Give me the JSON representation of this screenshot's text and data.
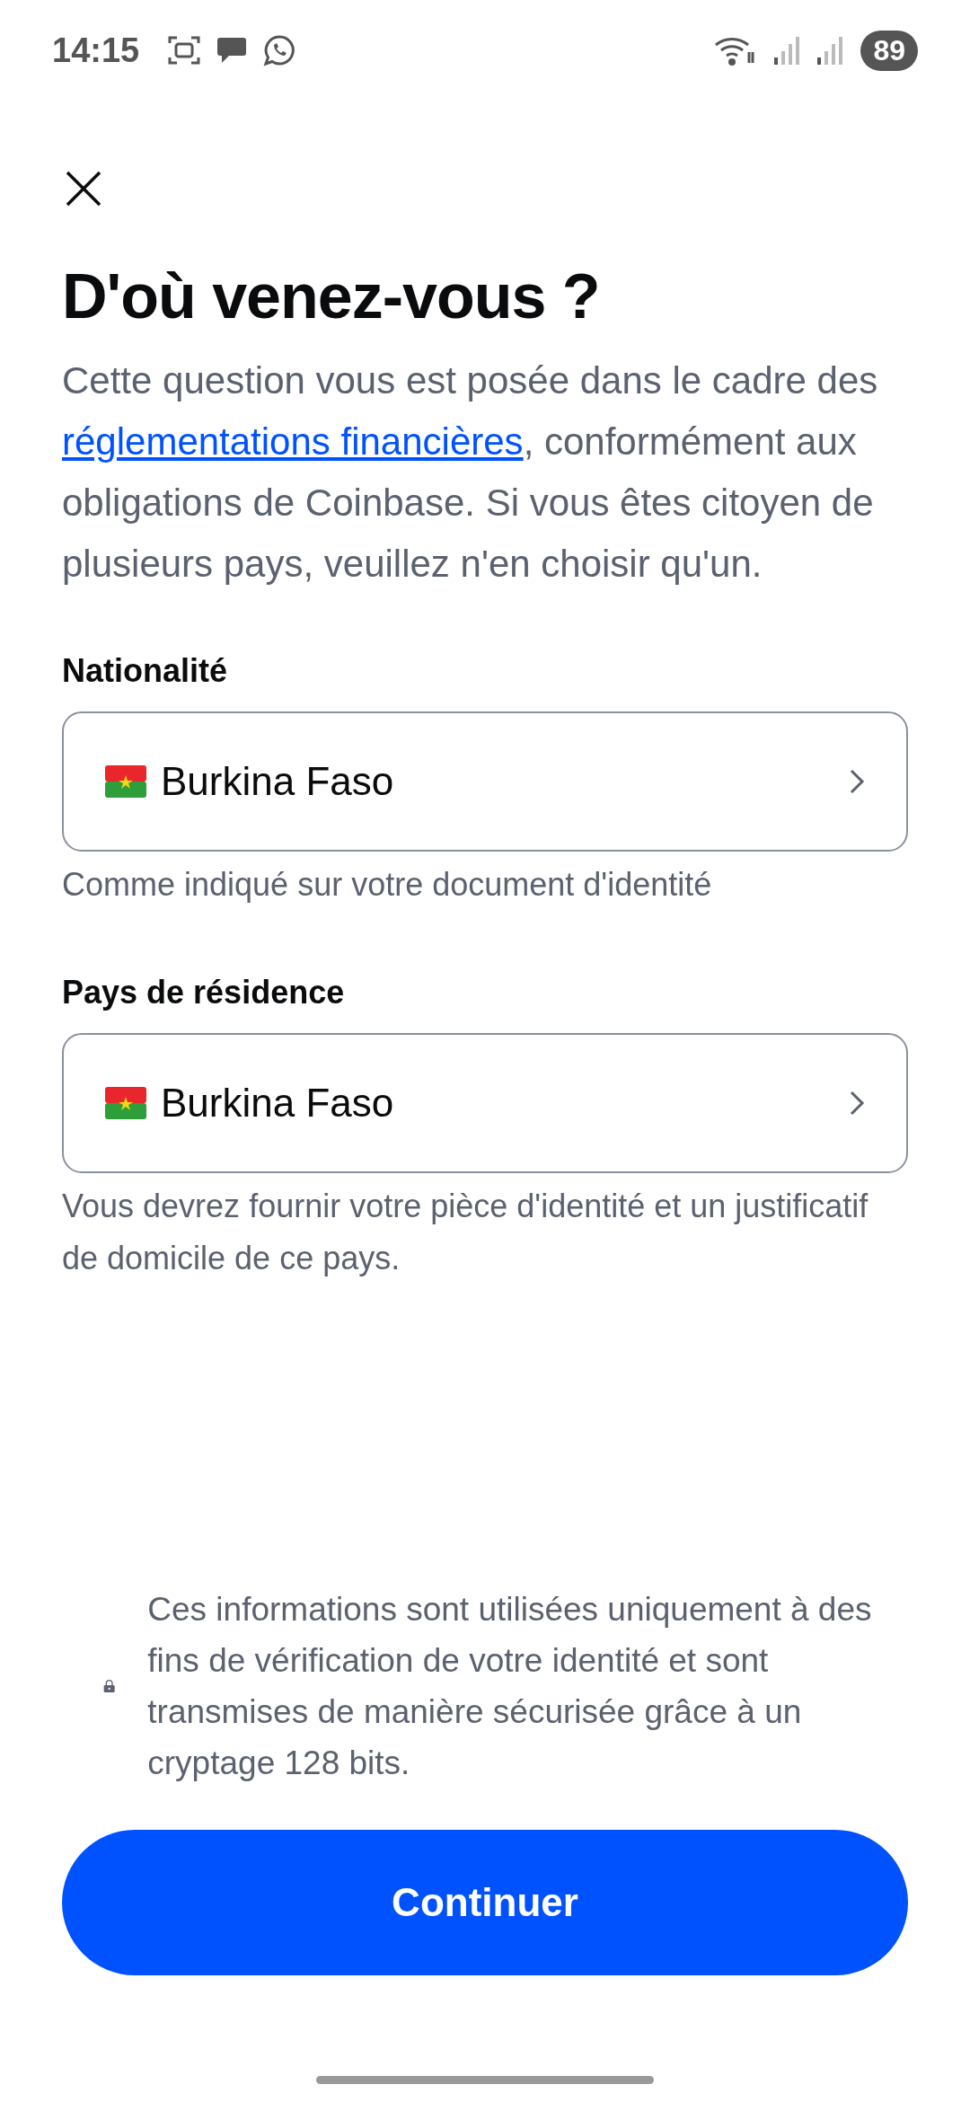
{
  "status_bar": {
    "time": "14:15",
    "battery": "89"
  },
  "title": "D'où venez-vous ?",
  "intro": {
    "before": "Cette question vous est posée dans le cadre des ",
    "link": "réglementations financières",
    "after": ", conformément aux obligations de Coinbase. Si vous êtes citoyen de plusieurs pays, veuillez n'en choisir qu'un."
  },
  "fields": [
    {
      "label": "Nationalité",
      "value": "Burkina Faso",
      "helper": "Comme indiqué sur votre document d'identité"
    },
    {
      "label": "Pays de résidence",
      "value": "Burkina Faso",
      "helper": "Vous devrez fournir votre pièce d'identité et un justificatif de domicile de ce pays."
    }
  ],
  "notice": "Ces informations sont utilisées uniquement à des fins de vérification de votre identité et sont transmises de manière sécurisée grâce à un cryptage 128 bits.",
  "button": "Continuer"
}
